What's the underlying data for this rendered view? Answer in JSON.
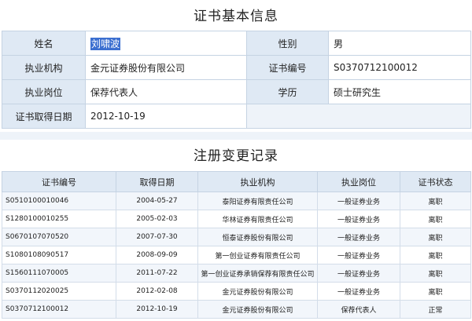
{
  "basic_info": {
    "title": "证书基本信息",
    "name_label": "姓名",
    "name_value": "刘啸波",
    "gender_label": "性别",
    "gender_value": "男",
    "org_label": "执业机构",
    "org_value": "金元证券股份有限公司",
    "cert_no_label": "证书编号",
    "cert_no_value": "S0370712100012",
    "position_label": "执业岗位",
    "position_value": "保荐代表人",
    "education_label": "学历",
    "education_value": "硕士研究生",
    "obtain_date_label": "证书取得日期",
    "obtain_date_value": "2012-10-19"
  },
  "history": {
    "title": "注册变更记录",
    "columns": [
      "证书编号",
      "取得日期",
      "执业机构",
      "执业岗位",
      "证书状态"
    ],
    "rows": [
      [
        "S0510100010046",
        "2004-05-27",
        "泰阳证券有限责任公司",
        "一般证券业务",
        "离职"
      ],
      [
        "S1280100010255",
        "2005-02-03",
        "华林证券有限责任公司",
        "一般证券业务",
        "离职"
      ],
      [
        "S0670107070520",
        "2007-07-30",
        "恒泰证券股份有限公司",
        "一般证券业务",
        "离职"
      ],
      [
        "S1080108090517",
        "2008-09-09",
        "第一创业证券有限责任公司",
        "一般证券业务",
        "离职"
      ],
      [
        "S1560111070005",
        "2011-07-22",
        "第一创业证券承销保荐有限责任公司",
        "一般证券业务",
        "离职"
      ],
      [
        "S0370112020025",
        "2012-02-08",
        "金元证券股份有限公司",
        "一般证券业务",
        "离职"
      ],
      [
        "S0370712100012",
        "2012-10-19",
        "金元证券股份有限公司",
        "保荐代表人",
        "正常"
      ]
    ]
  }
}
